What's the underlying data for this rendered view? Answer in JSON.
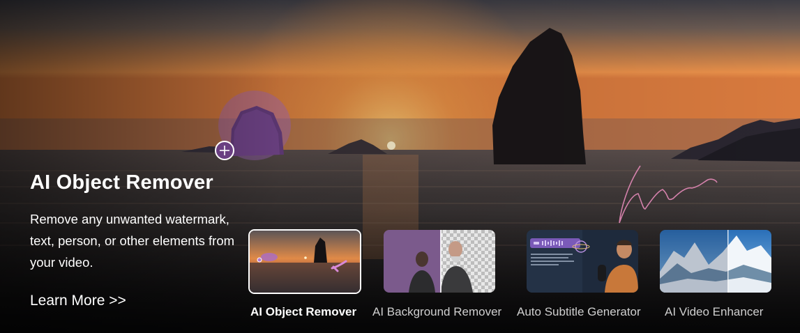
{
  "hero": {
    "title": "AI Object Remover",
    "description": "Remove any unwanted watermark, text, person, or other elements from your video.",
    "learn_more": "Learn More >>"
  },
  "tabs": [
    {
      "label": "AI Object Remover",
      "active": true
    },
    {
      "label": "AI Background Remover",
      "active": false
    },
    {
      "label": "Auto Subtitle Generator",
      "active": false
    },
    {
      "label": "AI Video Enhancer",
      "active": false
    }
  ],
  "colors": {
    "highlight": "#a86bc8",
    "sun": "#fff4d0",
    "active_label": "#ffffff",
    "inactive_label": "#cfcfcf"
  }
}
